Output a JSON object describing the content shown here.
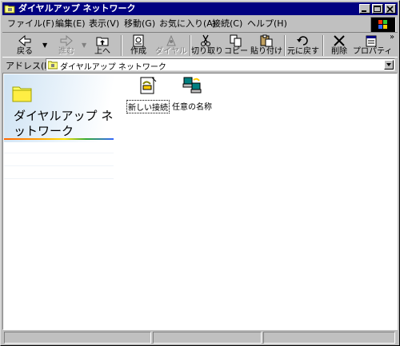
{
  "window": {
    "title": "ダイヤルアップ ネットワーク",
    "title_icon": "dialup-folder-icon",
    "controls": [
      "minimize-icon",
      "maximize-icon",
      "close-icon"
    ]
  },
  "menu": {
    "items": [
      "ファイル(F)",
      "編集(E)",
      "表示(V)",
      "移動(G)",
      "お気に入り(A)",
      "接続(C)",
      "ヘルプ(H)"
    ]
  },
  "toolbar": {
    "buttons": [
      {
        "label": "戻る",
        "icon": "back-arrow-icon",
        "enabled": true
      },
      {
        "label": "進む",
        "icon": "forward-arrow-icon",
        "enabled": false
      },
      {
        "label": "上へ",
        "icon": "up-folder-icon",
        "enabled": true
      },
      {
        "label": "作成",
        "icon": "create-icon",
        "enabled": true
      },
      {
        "label": "ダイヤル",
        "icon": "dial-icon",
        "enabled": false
      },
      {
        "label": "切り取り",
        "icon": "cut-icon",
        "enabled": true
      },
      {
        "label": "コピー",
        "icon": "copy-icon",
        "enabled": true
      },
      {
        "label": "貼り付け",
        "icon": "paste-icon",
        "enabled": true
      },
      {
        "label": "元に戻す",
        "icon": "undo-icon",
        "enabled": true
      },
      {
        "label": "削除",
        "icon": "delete-icon",
        "enabled": true
      },
      {
        "label": "プロパティ",
        "icon": "properties-icon",
        "enabled": true
      }
    ],
    "overflow": "»"
  },
  "address": {
    "label": "アドレス(D)",
    "value": "ダイヤルアップ ネットワーク"
  },
  "webview": {
    "title": "ダイヤルアップ ネットワーク"
  },
  "items": [
    {
      "label": "新しい接続",
      "icon": "new-connection-icon",
      "selected": true
    },
    {
      "label": "任意の名称",
      "icon": "connection-icon",
      "selected": false
    }
  ],
  "colors": {
    "titlebar": "#000080",
    "face": "#c0c0c0",
    "content_bg": "#ffffff"
  }
}
